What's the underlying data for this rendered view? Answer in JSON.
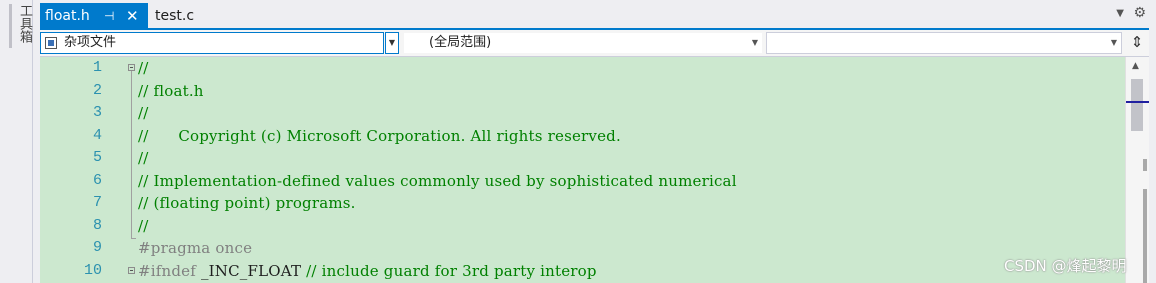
{
  "toolbox": {
    "label": "工具箱"
  },
  "tabs": {
    "active": {
      "label": "float.h",
      "pin_icon": "pin-icon",
      "close_icon": "close-icon"
    },
    "inactive": [
      {
        "label": "test.c"
      }
    ]
  },
  "navbar": {
    "project": {
      "label": "杂项文件"
    },
    "scope": {
      "label": "(全局范围)"
    },
    "member": {
      "label": ""
    }
  },
  "editor": {
    "lines": [
      {
        "n": "1",
        "text": "//"
      },
      {
        "n": "2",
        "text": "// float.h"
      },
      {
        "n": "3",
        "text": "//"
      },
      {
        "n": "4",
        "text": "//      Copyright (c) Microsoft Corporation. All rights reserved."
      },
      {
        "n": "5",
        "text": "//"
      },
      {
        "n": "6",
        "text": "// Implementation-defined values commonly used by sophisticated numerical"
      },
      {
        "n": "7",
        "text": "// (floating point) programs."
      },
      {
        "n": "8",
        "text": "//"
      },
      {
        "n": "9",
        "text": "#pragma once"
      },
      {
        "n": "10",
        "text_pre": "#ifndef",
        "text_plain": " _INC_FLOAT ",
        "text_comment": "// include guard for 3rd party interop"
      }
    ]
  },
  "watermark": "CSDN @烽起黎明",
  "colors": {
    "accent": "#007acc",
    "editor_bg": "#cce8cf",
    "comment": "#008000",
    "line_number": "#2b91af"
  }
}
